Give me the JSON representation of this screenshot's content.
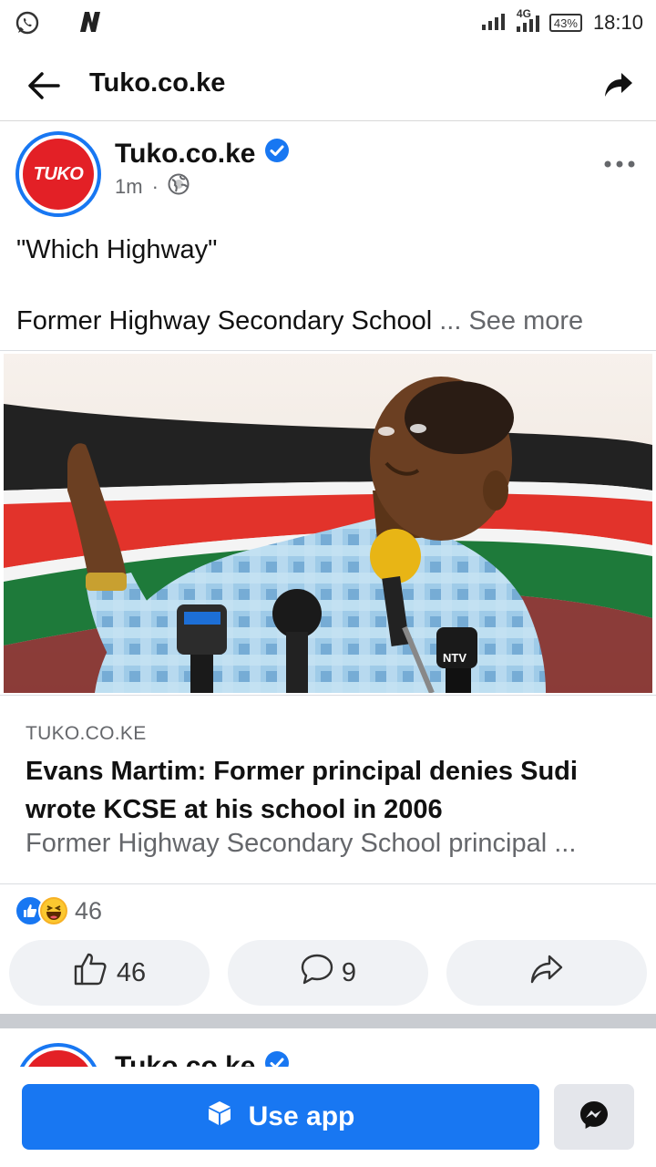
{
  "status_bar": {
    "network": "4G",
    "battery": "43%",
    "time": "18:10",
    "icons": [
      "whatsapp-icon",
      "n-app-icon",
      "signal-icon",
      "battery-icon"
    ]
  },
  "header": {
    "title": "Tuko.co.ke",
    "icons": [
      "back-arrow-icon",
      "share-icon"
    ]
  },
  "post": {
    "page_name": "Tuko.co.ke",
    "avatar_text": "TUKO",
    "time": "1m",
    "separator": "·",
    "privacy_icon": "globe-icon",
    "verified_icon": "verified-badge-icon",
    "text_line1": "\"Which Highway\"",
    "text_line2": "Former Highway Secondary School",
    "see_more": "... See more",
    "image_mic_label": "NTV"
  },
  "link": {
    "domain": "TUKO.CO.KE",
    "title": "Evans Martim: Former principal denies Sudi wrote KCSE at his school in 2006",
    "description": "Former Highway Secondary School principal ..."
  },
  "reactions": {
    "types": [
      "like-reaction-icon",
      "haha-reaction-icon"
    ],
    "count": "46"
  },
  "actions": {
    "like_count": "46",
    "comment_count": "9",
    "share_icon": "share-outline-icon"
  },
  "next_post": {
    "page_name": "Tuko.co.ke"
  },
  "bottom_bar": {
    "use_app_label": "Use app",
    "messenger_icon": "messenger-icon"
  },
  "colors": {
    "facebook_blue": "#1877f2",
    "tuko_red": "#e32026",
    "secondary_text": "#65676b",
    "button_gray": "#f0f2f5"
  }
}
